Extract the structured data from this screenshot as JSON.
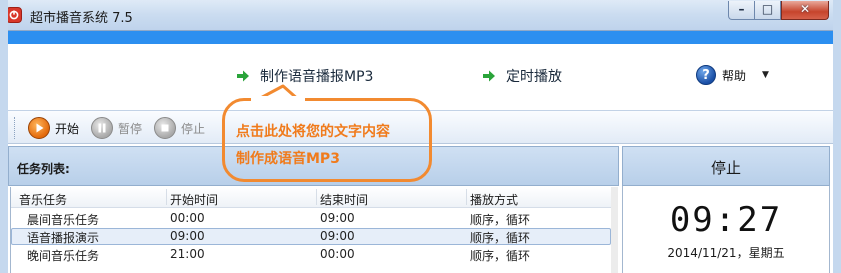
{
  "window": {
    "title": "超市播音系统 7.5",
    "controls": {
      "minimize": "–",
      "maximize": "□",
      "close": "✕"
    }
  },
  "menu": {
    "make_mp3": "制作语音播报MP3",
    "scheduled_play": "定时播放",
    "help": "帮助",
    "help_icon_glyph": "?"
  },
  "toolbar": {
    "start": "开始",
    "pause": "暂停",
    "stop": "停止"
  },
  "task_list": {
    "title": "任务列表:",
    "columns": [
      "音乐任务",
      "开始时间",
      "结束时间",
      "播放方式"
    ],
    "rows": [
      {
        "name": "晨间音乐任务",
        "start": "00:00",
        "end": "09:00",
        "mode": "顺序，循环"
      },
      {
        "name": "语音播报演示",
        "start": "09:00",
        "end": "09:00",
        "mode": "顺序，循环",
        "selected": true
      },
      {
        "name": "晚间音乐任务",
        "start": "21:00",
        "end": "00:00",
        "mode": "顺序，循环"
      }
    ]
  },
  "status_panel": {
    "state": "停止",
    "time": "09:27",
    "date": "2014/11/21，星期五"
  },
  "callout": {
    "line1": "点击此处将您的文字内容",
    "line2": "制作成语音MP3"
  },
  "colors": {
    "accent_blue": "#2c8ff0",
    "callout_orange": "#f28a30",
    "panel_header": "#c2d6ed"
  }
}
